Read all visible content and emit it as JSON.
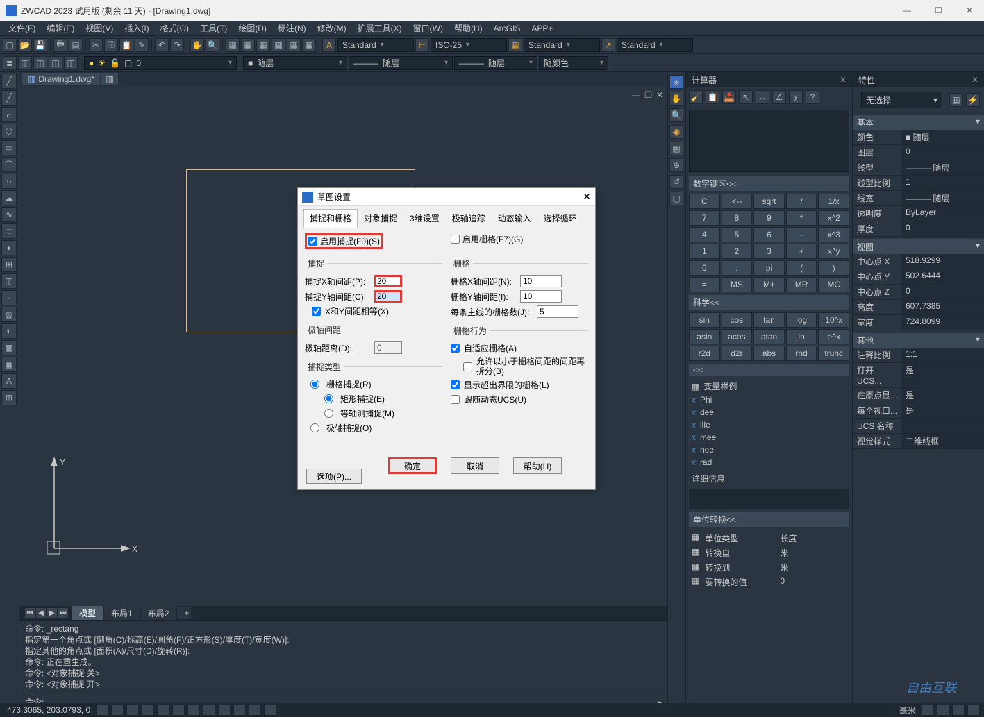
{
  "app": {
    "title": "ZWCAD 2023 试用版 (剩余 11 天) - [Drawing1.dwg]",
    "file_tab": "Drawing1.dwg*"
  },
  "menu": [
    "文件(F)",
    "编辑(E)",
    "视图(V)",
    "插入(I)",
    "格式(O)",
    "工具(T)",
    "绘图(D)",
    "标注(N)",
    "修改(M)",
    "扩展工具(X)",
    "窗口(W)",
    "帮助(H)",
    "ArcGIS",
    "APP+"
  ],
  "toolbar2": {
    "text_style": "Standard",
    "dim_style": "ISO-25",
    "table_style": "Standard",
    "mleader_style": "Standard"
  },
  "layer": {
    "current": "0",
    "linetype1": "随层",
    "linetype2": "随层",
    "color": "随颜色",
    "lineweight": "随层"
  },
  "bottom_tabs": {
    "model": "模型",
    "layout1": "布局1",
    "layout2": "布局2"
  },
  "command": {
    "lines": [
      "命令: _rectang",
      "指定第一个角点或 [倒角(C)/标高(E)/圆角(F)/正方形(S)/厚度(T)/宽度(W)]:",
      "指定其他的角点或 [面积(A)/尺寸(D)/旋转(R)]:",
      "命令: 正在重生成。",
      "命令: <对象捕捉 关>",
      "命令: <对象捕捉 开>"
    ],
    "prompt": "命令:"
  },
  "calculator": {
    "title": "计算器",
    "section_num": "数字键区<<",
    "rows_num": [
      [
        "C",
        "<--",
        "sqrt",
        "/",
        "1/x"
      ],
      [
        "7",
        "8",
        "9",
        "*",
        "x^2"
      ],
      [
        "4",
        "5",
        "6",
        "-",
        "x^3"
      ],
      [
        "1",
        "2",
        "3",
        "+",
        "x^y"
      ],
      [
        "0",
        ".",
        "pi",
        "(",
        ")"
      ],
      [
        "=",
        "MS",
        "M+",
        "MR",
        "MC"
      ]
    ],
    "section_sci": "科学<<",
    "rows_sci": [
      [
        "sin",
        "cos",
        "tan",
        "log",
        "10^x"
      ],
      [
        "asin",
        "acos",
        "atan",
        "ln",
        "e^x"
      ],
      [
        "r2d",
        "d2r",
        "abs",
        "rnd",
        "trunc"
      ]
    ],
    "section_var": "<<",
    "var_example": "变量样例",
    "vars": [
      "Phi",
      "dee",
      "ille",
      "mee",
      "nee",
      "rad"
    ],
    "detail": "详细信息",
    "unit_section": "单位转换<<",
    "unit_rows": [
      {
        "label": "单位类型",
        "value": "长度"
      },
      {
        "label": "转换自",
        "value": "米"
      },
      {
        "label": "转换到",
        "value": "米"
      },
      {
        "label": "要转换的值",
        "value": "0"
      }
    ]
  },
  "properties": {
    "title": "特性",
    "select": "无选择",
    "sections": {
      "basic": {
        "header": "基本",
        "rows": [
          {
            "k": "颜色",
            "v": "■ 随层"
          },
          {
            "k": "图层",
            "v": "0"
          },
          {
            "k": "线型",
            "v": "——— 随层"
          },
          {
            "k": "线型比例",
            "v": "1"
          },
          {
            "k": "线宽",
            "v": "——— 随层"
          },
          {
            "k": "透明度",
            "v": "ByLayer"
          },
          {
            "k": "厚度",
            "v": "0"
          }
        ]
      },
      "view": {
        "header": "视图",
        "rows": [
          {
            "k": "中心点 X",
            "v": "518.9299"
          },
          {
            "k": "中心点 Y",
            "v": "502.6444"
          },
          {
            "k": "中心点 Z",
            "v": "0"
          },
          {
            "k": "高度",
            "v": "607.7385"
          },
          {
            "k": "宽度",
            "v": "724.8099"
          }
        ]
      },
      "misc": {
        "header": "其他",
        "rows": [
          {
            "k": "注释比例",
            "v": "1:1"
          },
          {
            "k": "打开 UCS...",
            "v": "是"
          },
          {
            "k": "在原点显...",
            "v": "是"
          },
          {
            "k": "每个视口...",
            "v": "是"
          },
          {
            "k": "UCS 名称",
            "v": ""
          },
          {
            "k": "视觉样式",
            "v": "二维线框"
          }
        ]
      }
    }
  },
  "dialog": {
    "title": "草图设置",
    "tabs": [
      "捕捉和栅格",
      "对象捕捉",
      "3维设置",
      "极轴追踪",
      "动态输入",
      "选择循环"
    ],
    "enable_snap_label": "启用捕捉(F9)(S)",
    "enable_grid_label": "启用栅格(F7)(G)",
    "snap_group": "捕捉",
    "grid_group": "栅格",
    "snap_x_label": "捕捉X轴间距(P):",
    "snap_x_val": "20",
    "snap_y_label": "捕捉Y轴间距(C):",
    "snap_y_val": "20",
    "xy_equal_label": "X和Y间距相等(X)",
    "grid_x_label": "栅格X轴间距(N):",
    "grid_x_val": "10",
    "grid_y_label": "栅格Y轴间距(I):",
    "grid_y_val": "10",
    "grid_major_label": "每条主线的栅格数(J):",
    "grid_major_val": "5",
    "polar_group": "极轴间距",
    "polar_dist_label": "极轴距离(D):",
    "polar_dist_val": "0",
    "grid_behavior_group": "栅格行为",
    "adaptive_label": "自适应栅格(A)",
    "subdivide_label": "允许以小于栅格间距的间距再拆分(B)",
    "show_beyond_label": "显示超出界限的栅格(L)",
    "follow_ucs_label": "跟随动态UCS(U)",
    "snap_type_group": "捕捉类型",
    "grid_snap_label": "栅格捕捉(R)",
    "rect_snap_label": "矩形捕捉(E)",
    "iso_snap_label": "等轴测捕捉(M)",
    "polar_snap_label": "极轴捕捉(O)",
    "options_btn": "选项(P)...",
    "ok": "确定",
    "cancel": "取消",
    "help": "帮助(H)"
  },
  "status": {
    "coords": "473.3065, 203.0793, 0",
    "right_units": "毫米"
  },
  "ucs": {
    "x": "X",
    "y": "Y"
  },
  "watermark": "自由互联"
}
